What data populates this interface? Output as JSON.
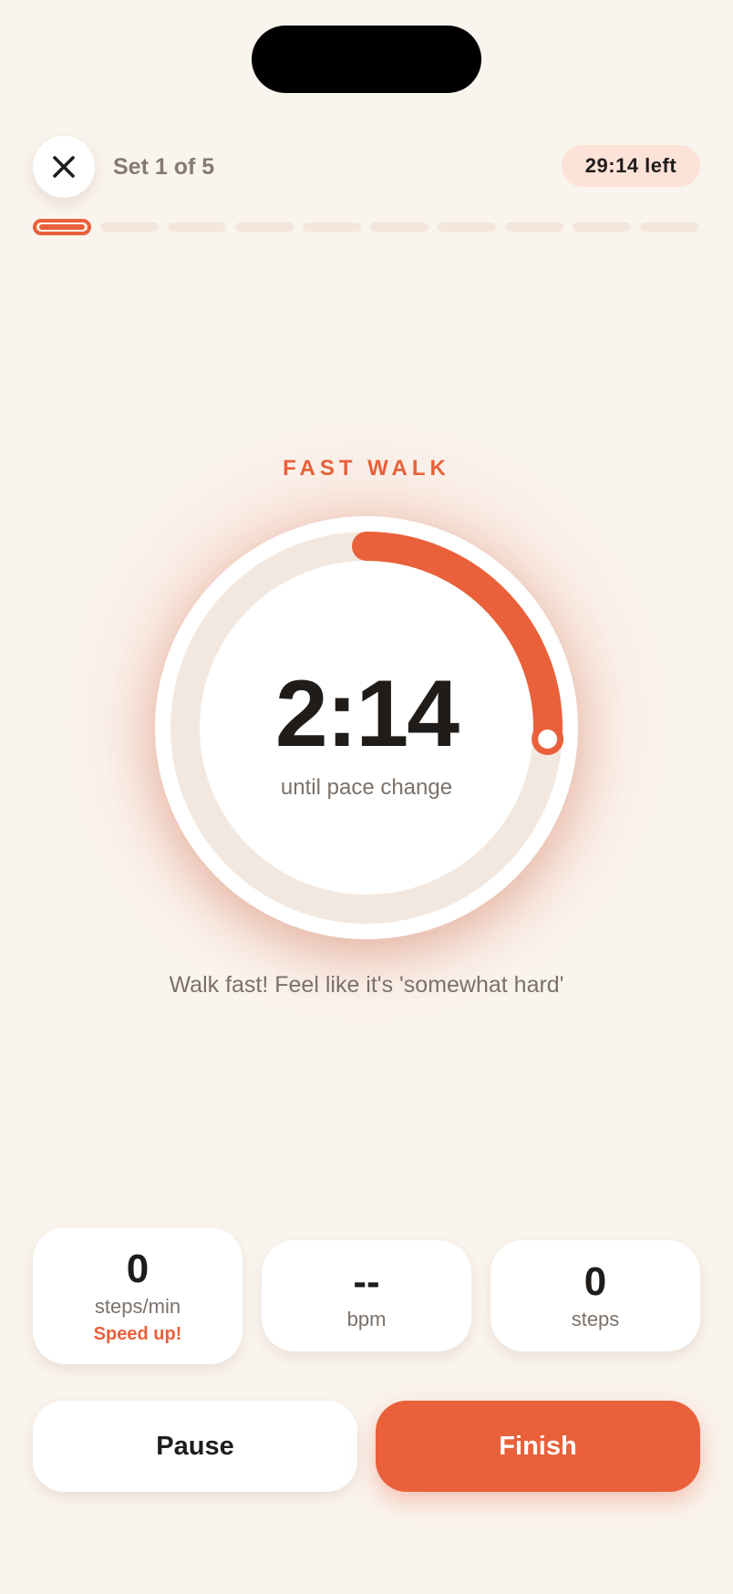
{
  "header": {
    "set_label": "Set 1 of 5",
    "time_left": "29:14 left",
    "progress": {
      "total_segments": 10,
      "current_segment": 1
    }
  },
  "icons": {
    "close": "close-icon"
  },
  "phase": {
    "name": "FAST WALK",
    "timer": "2:14",
    "timer_sub": "until pace change",
    "ring_progress": 0.26,
    "instruction": "Walk fast! Feel like it's 'somewhat hard'"
  },
  "stats": [
    {
      "value": "0",
      "unit": "steps/min",
      "hint": "Speed up!"
    },
    {
      "value": "--",
      "unit": "bpm"
    },
    {
      "value": "0",
      "unit": "steps"
    }
  ],
  "actions": {
    "pause_label": "Pause",
    "finish_label": "Finish"
  },
  "colors": {
    "accent": "#e9603a",
    "background": "#faf4ee",
    "ring_track": "#f3e8df",
    "badge": "#fde2d8"
  }
}
